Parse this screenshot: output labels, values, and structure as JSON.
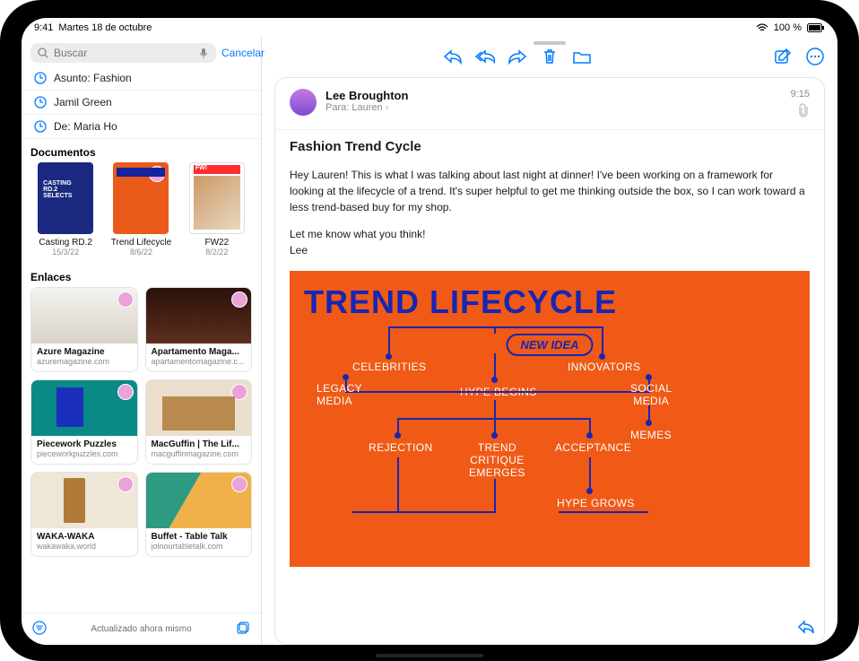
{
  "status": {
    "time": "9:41",
    "date": "Martes 18 de octubre",
    "battery": "100 %"
  },
  "search": {
    "placeholder": "Buscar",
    "cancel": "Cancelar"
  },
  "recent": [
    {
      "label": "Asunto: Fashion"
    },
    {
      "label": "Jamil Green"
    },
    {
      "label": "De: Maria Ho"
    }
  ],
  "documents": {
    "label": "Documentos",
    "items": [
      {
        "name": "Casting RD.2",
        "date": "15/3/22"
      },
      {
        "name": "Trend Lifecycle",
        "date": "8/6/22"
      },
      {
        "name": "FW22",
        "date": "8/2/22"
      }
    ]
  },
  "links": {
    "label": "Enlaces",
    "items": [
      {
        "title": "Azure Magazine",
        "domain": "azuremagazine.com"
      },
      {
        "title": "Apartamento Maga...",
        "domain": "apartamentomagazine.c..."
      },
      {
        "title": "Piecework Puzzles",
        "domain": "pieceworkpuzzles.com"
      },
      {
        "title": "MacGuffin | The Lif...",
        "domain": "macguffinmagazine.com"
      },
      {
        "title": "WAKA-WAKA",
        "domain": "wakawaka.world"
      },
      {
        "title": "Buffet - Table Talk",
        "domain": "joinourtabletalk.com"
      }
    ]
  },
  "sidebar_footer": {
    "status": "Actualizado ahora mismo"
  },
  "message": {
    "sender": "Lee Broughton",
    "to_prefix": "Para:",
    "to_name": "Lauren",
    "time": "9:15",
    "subject": "Fashion Trend Cycle",
    "body1": "Hey Lauren! This is what I was talking about last night at dinner! I've been working on a framework for looking at the lifecycle of a trend. It's super helpful to get me thinking outside the box, so I can work toward a less trend-based buy for my shop.",
    "body2": "Let me know what you think!",
    "body3": "Lee"
  },
  "infographic": {
    "title": "TREND LIFECYCLE",
    "new_idea": "NEW IDEA",
    "celebrities": "CELEBRITIES",
    "innovators": "INNOVATORS",
    "legacy_media": "LEGACY\nMEDIA",
    "hype_begins": "HYPE BEGINS",
    "social_media": "SOCIAL\nMEDIA",
    "rejection": "REJECTION",
    "trend_critique": "TREND\nCRITIQUE\nEMERGES",
    "acceptance": "ACCEPTANCE",
    "memes": "MEMES",
    "hype_grows": "HYPE GROWS"
  }
}
